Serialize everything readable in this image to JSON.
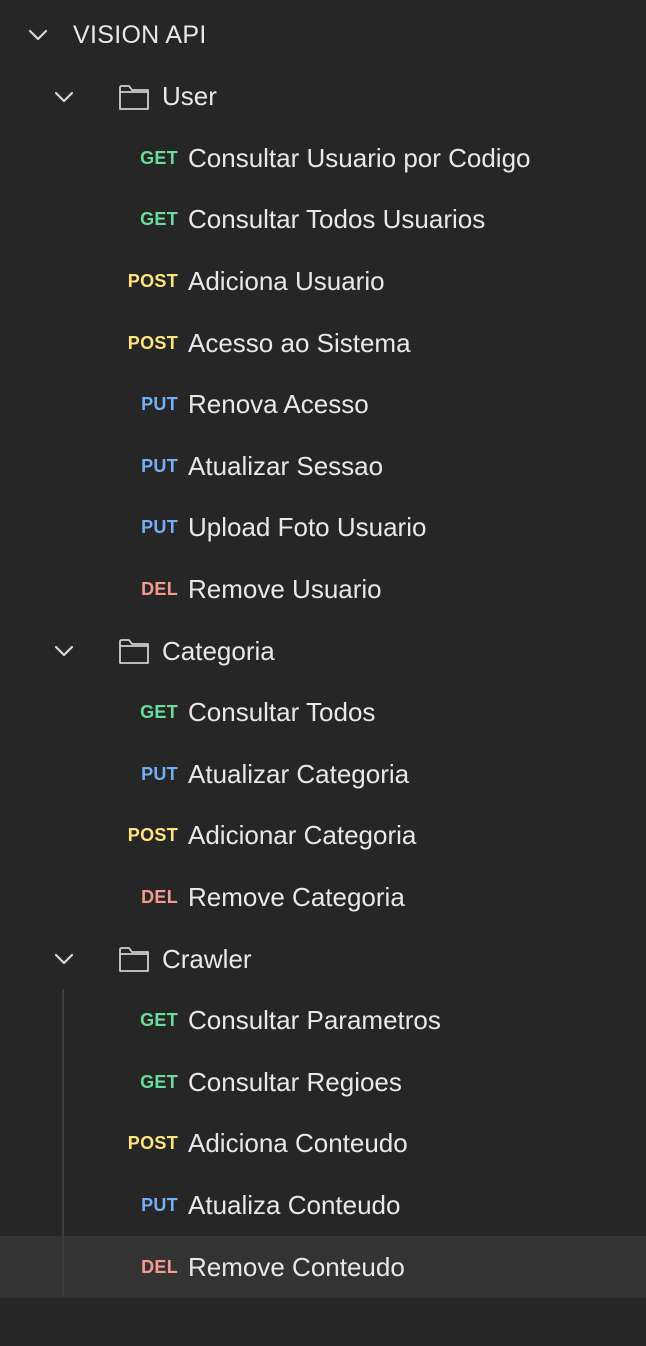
{
  "collection": {
    "name": "VISION API",
    "folders": [
      {
        "name": "User",
        "requests": [
          {
            "method": "GET",
            "name": "Consultar Usuario por Codigo"
          },
          {
            "method": "GET",
            "name": "Consultar Todos Usuarios"
          },
          {
            "method": "POST",
            "name": "Adiciona Usuario"
          },
          {
            "method": "POST",
            "name": "Acesso ao Sistema"
          },
          {
            "method": "PUT",
            "name": "Renova Acesso"
          },
          {
            "method": "PUT",
            "name": "Atualizar Sessao"
          },
          {
            "method": "PUT",
            "name": "Upload Foto Usuario"
          },
          {
            "method": "DEL",
            "name": "Remove Usuario"
          }
        ]
      },
      {
        "name": "Categoria",
        "requests": [
          {
            "method": "GET",
            "name": "Consultar Todos"
          },
          {
            "method": "PUT",
            "name": "Atualizar Categoria"
          },
          {
            "method": "POST",
            "name": "Adicionar Categoria"
          },
          {
            "method": "DEL",
            "name": "Remove Categoria"
          }
        ]
      },
      {
        "name": "Crawler",
        "requests": [
          {
            "method": "GET",
            "name": "Consultar Parametros"
          },
          {
            "method": "GET",
            "name": "Consultar Regioes"
          },
          {
            "method": "POST",
            "name": "Adiciona Conteudo"
          },
          {
            "method": "PUT",
            "name": "Atualiza Conteudo"
          },
          {
            "method": "DEL",
            "name": "Remove Conteudo"
          }
        ]
      }
    ]
  },
  "method_colors": {
    "GET": "#6bdd9a",
    "POST": "#ffe47e",
    "PUT": "#74aef6",
    "DEL": "#f79a8e"
  },
  "selected_request": "Remove Conteudo"
}
